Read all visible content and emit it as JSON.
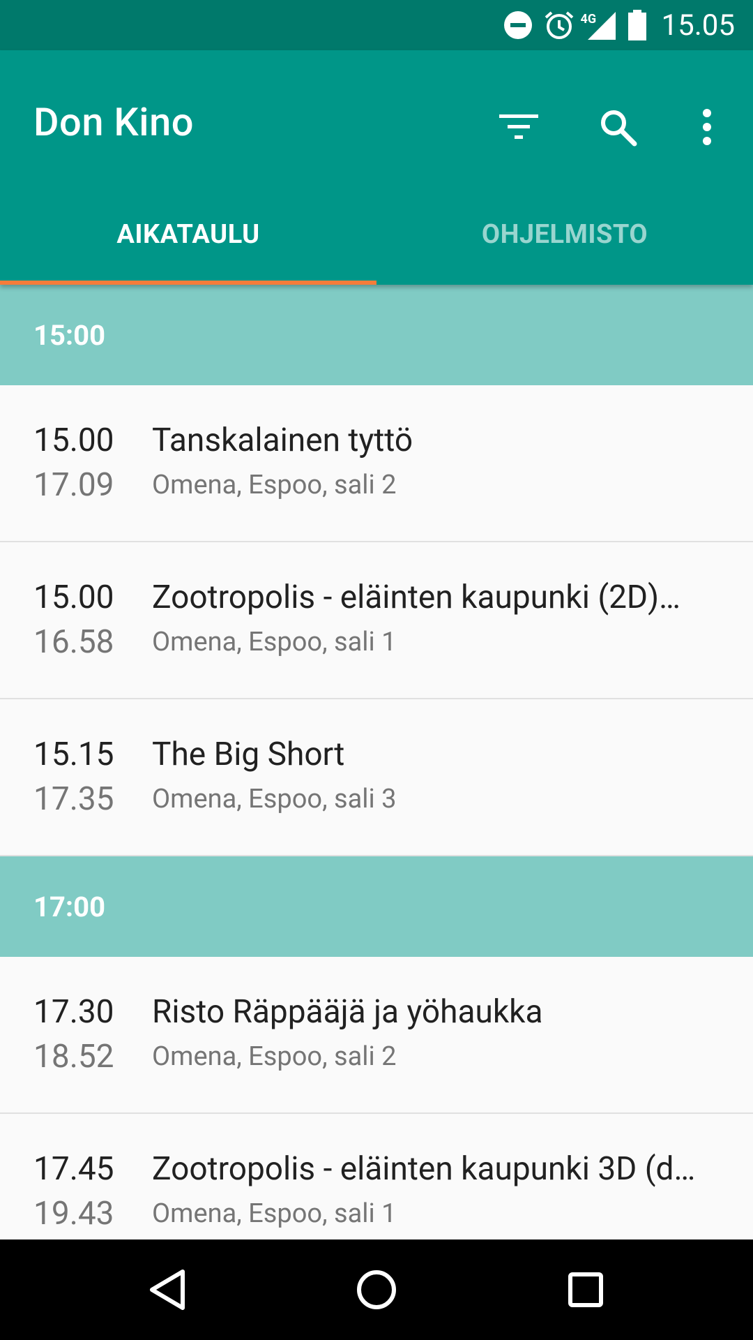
{
  "status_bar": {
    "time": "15.05",
    "network": "4G",
    "icons": [
      "do-not-disturb-icon",
      "alarm-icon",
      "signal-icon",
      "battery-icon"
    ]
  },
  "app_bar": {
    "title": "Don Kino",
    "actions": [
      "filter-icon",
      "search-icon",
      "more-vert-icon"
    ],
    "color": "#009688"
  },
  "tabs": [
    {
      "label": "AIKATAULU",
      "active": true
    },
    {
      "label": "OHJELMISTO",
      "active": false
    }
  ],
  "schedule": [
    {
      "header": "15:00",
      "items": [
        {
          "start": "15.00",
          "end": "17.09",
          "title": "Tanskalainen tyttö",
          "venue": "Omena, Espoo, sali 2"
        },
        {
          "start": "15.00",
          "end": "16.58",
          "title": "Zootropolis - eläinten kaupunki (2D)…",
          "venue": "Omena, Espoo, sali 1"
        },
        {
          "start": "15.15",
          "end": "17.35",
          "title": "The Big Short",
          "venue": "Omena, Espoo, sali 3"
        }
      ]
    },
    {
      "header": "17:00",
      "items": [
        {
          "start": "17.30",
          "end": "18.52",
          "title": "Risto Räppääjä ja yöhaukka",
          "venue": "Omena, Espoo, sali 2"
        },
        {
          "start": "17.45",
          "end": "19.43",
          "title": "Zootropolis - eläinten kaupunki 3D (d…",
          "venue": "Omena, Espoo, sali 1"
        }
      ]
    }
  ],
  "nav_bar": [
    "back-icon",
    "home-icon",
    "recents-icon"
  ],
  "colors": {
    "status_bar": "#00796B",
    "primary": "#009688",
    "section_header": "#80CBC4",
    "tab_indicator": "#F57C3A"
  }
}
